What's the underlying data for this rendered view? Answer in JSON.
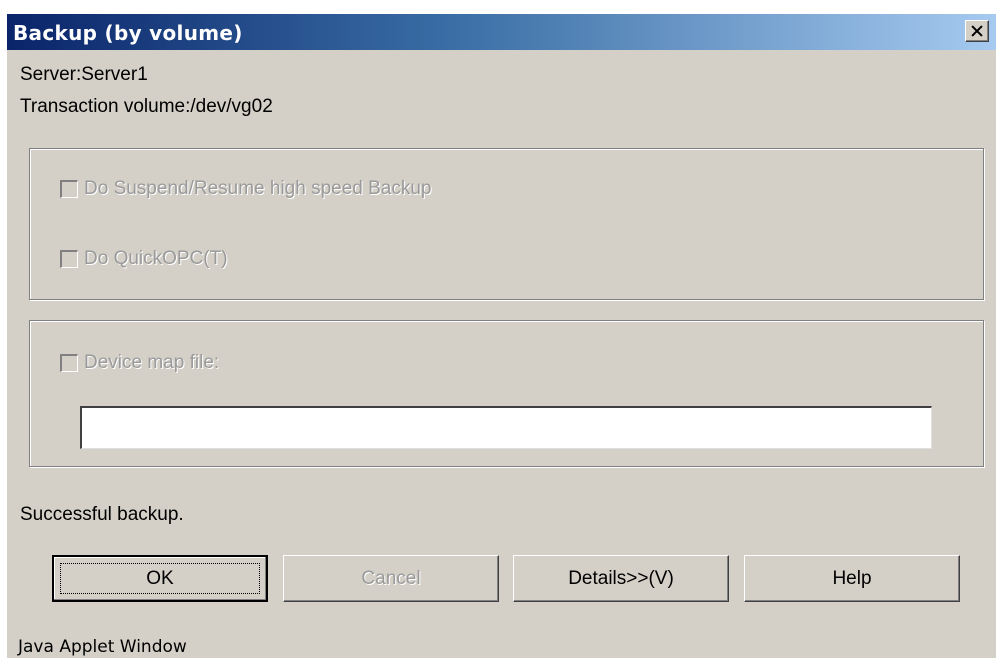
{
  "window": {
    "title": "Backup (by volume)"
  },
  "info": {
    "server": "Server:Server1",
    "transaction_volume": "Transaction volume:/dev/vg02"
  },
  "options": {
    "suspend_resume_label": "Do Suspend/Resume high speed Backup",
    "quickopc_label": "Do QuickOPC(T)"
  },
  "device_map": {
    "label": "Device map file:",
    "value": ""
  },
  "status": "Successful backup.",
  "buttons": {
    "ok": "OK",
    "cancel": "Cancel",
    "details": "Details>>(V)",
    "help": "Help"
  },
  "footer": "Java Applet Window",
  "colors": {
    "dialog_bg": "#d4d0c8",
    "titlebar_start": "#0a246a",
    "titlebar_end": "#a6caf0",
    "disabled_text": "#9a9a9a"
  }
}
